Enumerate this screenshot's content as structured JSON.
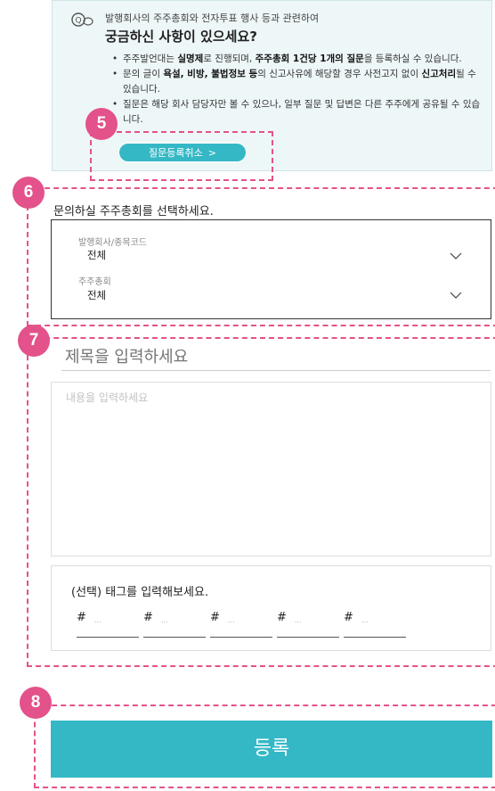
{
  "info": {
    "icon": "qna-chat-icon",
    "subtitle": "발행회사의 주주총회와 전자투표 행사 등과 관련하여",
    "title": "궁금하신 사항이 있으세요?",
    "bullets": [
      [
        "주주발언대는 ",
        {
          "b": "실명제"
        },
        "로 진행되며, ",
        {
          "b": "주주총회 1건당 1개의 질문"
        },
        "을 등록하실 수 있습니다."
      ],
      [
        "문의 글이 ",
        {
          "b": "욕설, 비방, 불법정보 등"
        },
        "의 신고사유에 해당할 경우 사전고지 없이 ",
        {
          "b": "신고처리"
        },
        "될 수 있습니다."
      ],
      [
        "질문은 해당 회사 담당자만 볼 수 있으나, 일부 질문 및 답변은 다른 주주에게 공유될 수 있습니다."
      ]
    ],
    "cancel_label": "질문등록취소",
    "cancel_arrow": ">"
  },
  "badges": {
    "b5": "5",
    "b6": "6",
    "b7": "7",
    "b8": "8"
  },
  "select": {
    "label": "문의하실 주주총회를 선택하세요.",
    "company_caption": "발행회사/종목코드",
    "company_value": "전체",
    "meeting_caption": "주주총회",
    "meeting_value": "전체"
  },
  "form": {
    "title_placeholder": "제목을 입력하세요",
    "content_placeholder": "내용을 입력하세요",
    "tag_title": "(선택) 태그를 입력해보세요.",
    "tags": [
      {
        "hash": "#",
        "placeholder": "..."
      },
      {
        "hash": "#",
        "placeholder": "..."
      },
      {
        "hash": "#",
        "placeholder": "..."
      },
      {
        "hash": "#",
        "placeholder": "..."
      },
      {
        "hash": "#",
        "placeholder": "..."
      }
    ]
  },
  "submit_label": "등록",
  "colors": {
    "accent": "#35b8c6",
    "callout": "#e3528a",
    "info_bg": "#eef7f8"
  }
}
